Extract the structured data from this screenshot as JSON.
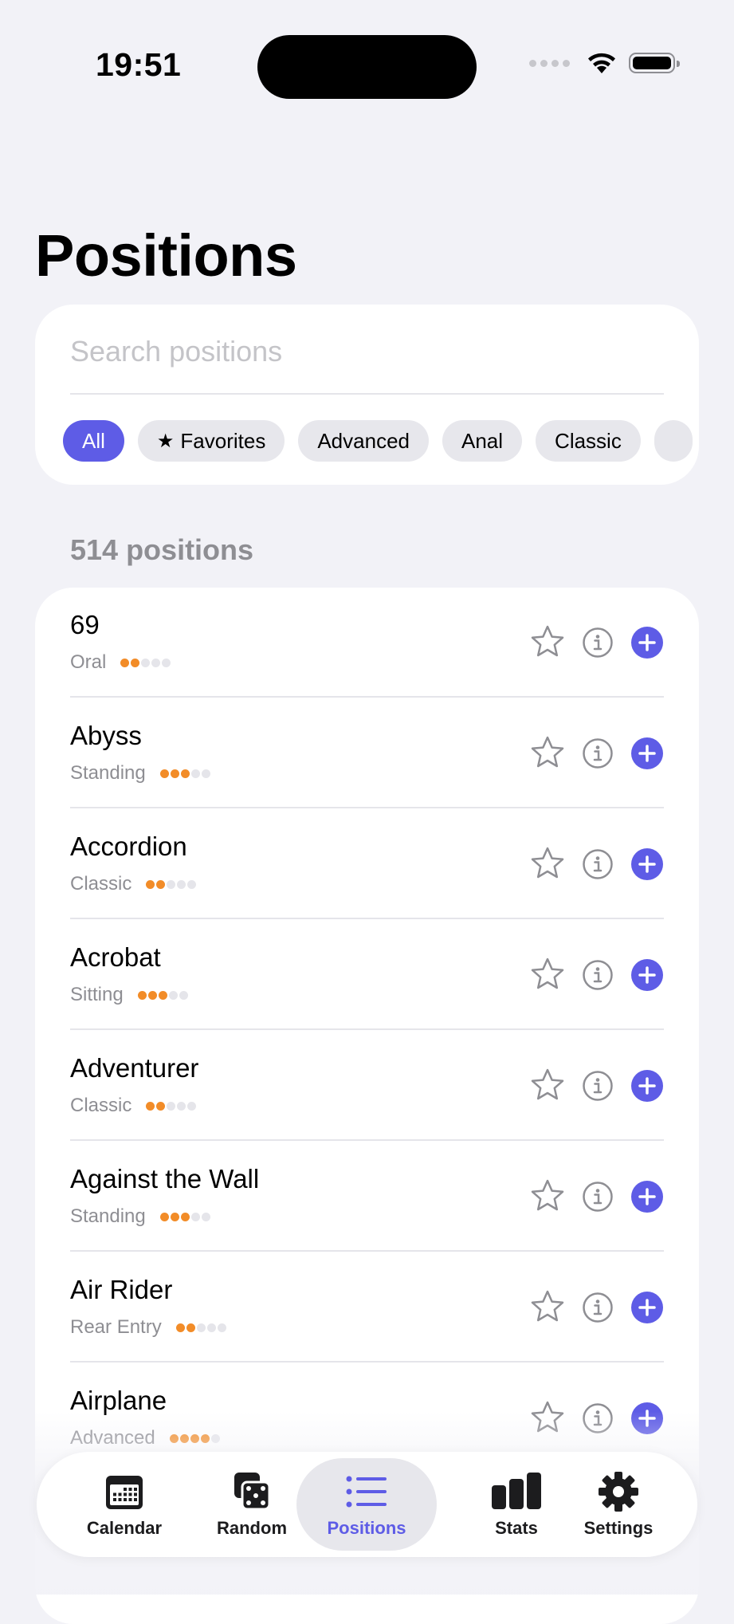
{
  "status_bar": {
    "time": "19:51"
  },
  "page": {
    "title": "Positions"
  },
  "search": {
    "placeholder": "Search positions",
    "value": ""
  },
  "filters": [
    {
      "label": "All",
      "active": true,
      "icon": ""
    },
    {
      "label": "Favorites",
      "active": false,
      "icon": "star-filled-icon"
    },
    {
      "label": "Advanced",
      "active": false,
      "icon": ""
    },
    {
      "label": "Anal",
      "active": false,
      "icon": ""
    },
    {
      "label": "Classic",
      "active": false,
      "icon": ""
    }
  ],
  "count_label": "514 positions",
  "positions": [
    {
      "name": "69",
      "category": "Oral",
      "difficulty": 2
    },
    {
      "name": "Abyss",
      "category": "Standing",
      "difficulty": 3
    },
    {
      "name": "Accordion",
      "category": "Classic",
      "difficulty": 2
    },
    {
      "name": "Acrobat",
      "category": "Sitting",
      "difficulty": 3
    },
    {
      "name": "Adventurer",
      "category": "Classic",
      "difficulty": 2
    },
    {
      "name": "Against the Wall",
      "category": "Standing",
      "difficulty": 3
    },
    {
      "name": "Air Rider",
      "category": "Rear Entry",
      "difficulty": 2
    },
    {
      "name": "Airplane",
      "category": "Advanced",
      "difficulty": 4
    }
  ],
  "difficulty_max": 5,
  "tabs": [
    {
      "label": "Calendar",
      "icon": "calendar-icon",
      "active": false
    },
    {
      "label": "Random",
      "icon": "dice-icon",
      "active": false
    },
    {
      "label": "Positions",
      "icon": "list-icon",
      "active": true
    },
    {
      "label": "Stats",
      "icon": "bar-chart-icon",
      "active": false
    },
    {
      "label": "Settings",
      "icon": "gear-icon",
      "active": false
    }
  ],
  "colors": {
    "accent": "#5e5ce6",
    "difficulty_on": "#f28c28",
    "difficulty_off": "#e5e5ea",
    "background": "#f2f2f7"
  }
}
